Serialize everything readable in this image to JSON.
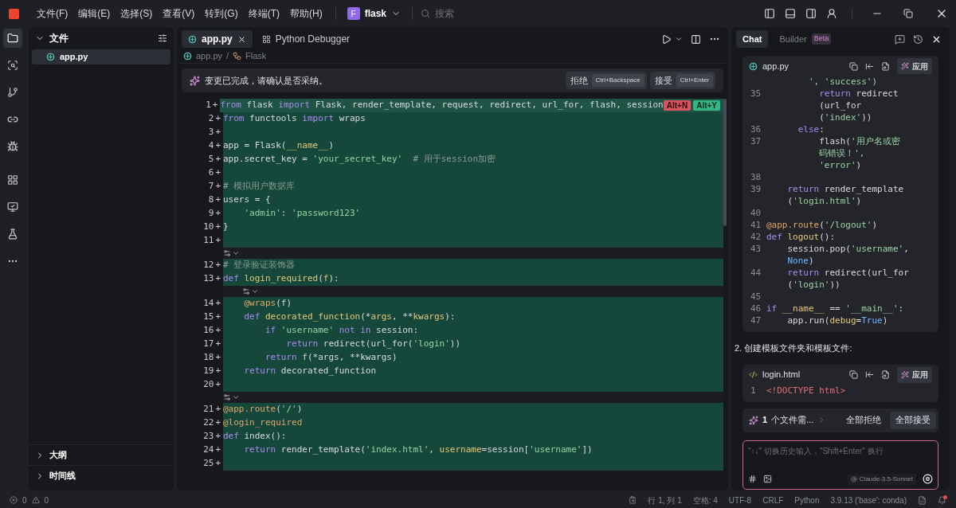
{
  "menu": [
    "文件(F)",
    "编辑(E)",
    "选择(S)",
    "查看(V)",
    "转到(G)",
    "终端(T)",
    "帮助(H)"
  ],
  "project": {
    "initial": "F",
    "name": "flask"
  },
  "search": {
    "placeholder": "搜索"
  },
  "activity_bar": [
    {
      "kind": "files",
      "selected": true
    },
    {
      "kind": "search",
      "selected": false
    },
    {
      "kind": "git",
      "selected": false
    },
    {
      "kind": "remote",
      "selected": false
    },
    {
      "kind": "debug",
      "selected": false
    },
    {
      "kind": "extensions",
      "selected": false
    },
    {
      "kind": "preview",
      "selected": false
    },
    {
      "kind": "testing",
      "selected": false
    },
    {
      "kind": "more",
      "selected": false
    }
  ],
  "sidebar": {
    "title": "文件",
    "files": [
      {
        "name": "app.py",
        "selected": true
      }
    ],
    "sections": [
      {
        "title": "大纲",
        "expanded": false
      },
      {
        "title": "时间线",
        "expanded": false
      }
    ]
  },
  "editor": {
    "tabs": [
      {
        "label": "app.py",
        "kind": "python",
        "selected": true
      },
      {
        "label": "Python Debugger",
        "kind": "extension",
        "selected": false
      }
    ],
    "breadcrumb": {
      "separator": "/",
      "items": [
        {
          "label": "app.py",
          "kind": "python"
        },
        {
          "label": "Flask",
          "kind": "symbol"
        }
      ]
    },
    "banner": {
      "message": "变更已完成，请确认是否采纳。",
      "actions": [
        {
          "label": "拒绝",
          "shortcut": "Ctrl+Backspace"
        },
        {
          "label": "接受",
          "shortcut": "Ctrl+Enter"
        }
      ]
    },
    "blocks": [
      {
        "kind": "lines",
        "lines": [
          {
            "num": "1",
            "mark": "+",
            "tokens": [
              {
                "kind": "keyword",
                "text": "from"
              },
              {
                "kind": "plain",
                "text": " flask "
              },
              {
                "kind": "keyword",
                "text": "import"
              },
              {
                "kind": "plain",
                "text": " Flask, render_template, request, redirect, url_for, flash, session"
              }
            ],
            "actions": [
              {
                "label": "Alt+N",
                "kind": "reject"
              },
              {
                "label": "Alt+Y",
                "kind": "accept"
              }
            ]
          },
          {
            "num": "2",
            "mark": "+",
            "tokens": [
              {
                "kind": "keyword",
                "text": "from"
              },
              {
                "kind": "plain",
                "text": " functools "
              },
              {
                "kind": "keyword",
                "text": "import"
              },
              {
                "kind": "plain",
                "text": " wraps"
              }
            ]
          },
          {
            "num": "3",
            "mark": "+"
          },
          {
            "num": "4",
            "mark": "+",
            "tokens": [
              {
                "kind": "plain",
                "text": "app = Flask("
              },
              {
                "kind": "function",
                "text": "__name__"
              },
              {
                "kind": "plain",
                "text": ")"
              }
            ]
          },
          {
            "num": "5",
            "mark": "+",
            "tokens": [
              {
                "kind": "plain",
                "text": "app.secret_key = "
              },
              {
                "kind": "string",
                "text": "'your_secret_key'"
              },
              {
                "kind": "comment",
                "text": "  # 用于session加密"
              }
            ]
          },
          {
            "num": "6",
            "mark": "+"
          },
          {
            "num": "7",
            "mark": "+",
            "tokens": [
              {
                "kind": "comment",
                "text": "# 模拟用户数据库"
              }
            ]
          },
          {
            "num": "8",
            "mark": "+",
            "tokens": [
              {
                "kind": "plain",
                "text": "users = {"
              }
            ]
          },
          {
            "num": "9",
            "mark": "+",
            "tokens": [
              {
                "kind": "string",
                "text": "    'admin'"
              },
              {
                "kind": "plain",
                "text": ": "
              },
              {
                "kind": "string",
                "text": "'password123'"
              }
            ]
          },
          {
            "num": "10",
            "mark": "+",
            "tokens": [
              {
                "kind": "plain",
                "text": "}"
              }
            ]
          },
          {
            "num": "11",
            "mark": "+"
          }
        ]
      },
      {
        "kind": "fold",
        "indented": false
      },
      {
        "kind": "lines",
        "lines": [
          {
            "num": "12",
            "mark": "+",
            "tokens": [
              {
                "kind": "comment",
                "text": "# 登录验证装饰器"
              }
            ]
          },
          {
            "num": "13",
            "mark": "+",
            "tokens": [
              {
                "kind": "keyword",
                "text": "def"
              },
              {
                "kind": "function",
                "text": " login_required"
              },
              {
                "kind": "plain",
                "text": "("
              },
              {
                "kind": "function",
                "text": "f"
              },
              {
                "kind": "plain",
                "text": "):"
              }
            ]
          }
        ]
      },
      {
        "kind": "fold",
        "indented": true
      },
      {
        "kind": "lines",
        "lines": [
          {
            "num": "14",
            "mark": "+",
            "tokens": [
              {
                "kind": "decorator",
                "text": "    @wraps"
              },
              {
                "kind": "plain",
                "text": "(f)"
              }
            ]
          },
          {
            "num": "15",
            "mark": "+",
            "tokens": [
              {
                "kind": "keyword",
                "text": "    def"
              },
              {
                "kind": "function",
                "text": " decorated_function"
              },
              {
                "kind": "plain",
                "text": "(*"
              },
              {
                "kind": "function",
                "text": "args"
              },
              {
                "kind": "plain",
                "text": ", **"
              },
              {
                "kind": "function",
                "text": "kwargs"
              },
              {
                "kind": "plain",
                "text": "):"
              }
            ]
          },
          {
            "num": "16",
            "mark": "+",
            "tokens": [
              {
                "kind": "keyword",
                "text": "        if"
              },
              {
                "kind": "string",
                "text": " 'username'"
              },
              {
                "kind": "keyword",
                "text": " not in"
              },
              {
                "kind": "plain",
                "text": " session:"
              }
            ]
          },
          {
            "num": "17",
            "mark": "+",
            "tokens": [
              {
                "kind": "keyword",
                "text": "            return"
              },
              {
                "kind": "plain",
                "text": " redirect(url_for("
              },
              {
                "kind": "string",
                "text": "'login'"
              },
              {
                "kind": "plain",
                "text": "))"
              }
            ]
          },
          {
            "num": "18",
            "mark": "+",
            "tokens": [
              {
                "kind": "keyword",
                "text": "        return"
              },
              {
                "kind": "plain",
                "text": " f(*args, **kwargs)"
              }
            ]
          },
          {
            "num": "19",
            "mark": "+",
            "tokens": [
              {
                "kind": "keyword",
                "text": "    return"
              },
              {
                "kind": "plain",
                "text": " decorated_function"
              }
            ]
          },
          {
            "num": "20",
            "mark": "+"
          }
        ]
      },
      {
        "kind": "fold",
        "indented": false
      },
      {
        "kind": "lines",
        "lines": [
          {
            "num": "21",
            "mark": "+",
            "tokens": [
              {
                "kind": "decorator",
                "text": "@app.route"
              },
              {
                "kind": "plain",
                "text": "("
              },
              {
                "kind": "string",
                "text": "'/'"
              },
              {
                "kind": "plain",
                "text": ")"
              }
            ]
          },
          {
            "num": "22",
            "mark": "+",
            "tokens": [
              {
                "kind": "decorator",
                "text": "@login_required"
              }
            ]
          },
          {
            "num": "23",
            "mark": "+",
            "tokens": [
              {
                "kind": "keyword",
                "text": "def"
              },
              {
                "kind": "plain",
                "text": " index():"
              }
            ]
          },
          {
            "num": "24",
            "mark": "+",
            "tokens": [
              {
                "kind": "keyword",
                "text": "    return"
              },
              {
                "kind": "plain",
                "text": " render_template("
              },
              {
                "kind": "string",
                "text": "'index.html'"
              },
              {
                "kind": "plain",
                "text": ", "
              },
              {
                "kind": "function",
                "text": "username"
              },
              {
                "kind": "plain",
                "text": "=session["
              },
              {
                "kind": "string",
                "text": "'username'"
              },
              {
                "kind": "plain",
                "text": "])"
              }
            ]
          },
          {
            "num": "25",
            "mark": "+"
          }
        ]
      }
    ]
  },
  "chat": {
    "tabs": [
      {
        "label": "Chat",
        "selected": true
      },
      {
        "label": "Builder",
        "badge": "Beta",
        "selected": false
      }
    ],
    "messages": [
      {
        "kind": "code",
        "file": {
          "name": "app.py",
          "kind": "python"
        },
        "apply": "应用",
        "rows": [
          {
            "tokens": [
              {
                "kind": "string",
                "text": "        ', 'success')"
              }
            ]
          },
          {
            "num": "35",
            "tokens": [
              {
                "kind": "keyword",
                "text": "          return"
              },
              {
                "kind": "plain",
                "text": " redirect"
              }
            ]
          },
          {
            "tokens": [
              {
                "kind": "plain",
                "text": "          (url_for"
              }
            ]
          },
          {
            "tokens": [
              {
                "kind": "plain",
                "text": "          ("
              },
              {
                "kind": "string",
                "text": "'index'"
              },
              {
                "kind": "plain",
                "text": "))"
              }
            ]
          },
          {
            "num": "36",
            "tokens": [
              {
                "kind": "keyword",
                "text": "      else"
              },
              {
                "kind": "plain",
                "text": ":"
              }
            ]
          },
          {
            "num": "37",
            "tokens": [
              {
                "kind": "plain",
                "text": "          flash("
              },
              {
                "kind": "string",
                "text": "'用户名或密"
              }
            ]
          },
          {
            "tokens": [
              {
                "kind": "string",
                "text": "          码错误！',"
              }
            ]
          },
          {
            "tokens": [
              {
                "kind": "string",
                "text": "          'error'"
              },
              {
                "kind": "plain",
                "text": ")"
              }
            ]
          },
          {
            "num": "38"
          },
          {
            "num": "39",
            "tokens": [
              {
                "kind": "keyword",
                "text": "    return"
              },
              {
                "kind": "plain",
                "text": " render_template"
              }
            ]
          },
          {
            "tokens": [
              {
                "kind": "plain",
                "text": "    ("
              },
              {
                "kind": "string",
                "text": "'login.html'"
              },
              {
                "kind": "plain",
                "text": ")"
              }
            ]
          },
          {
            "num": "40"
          },
          {
            "num": "41",
            "tokens": [
              {
                "kind": "decorator",
                "text": "@app.route"
              },
              {
                "kind": "plain",
                "text": "("
              },
              {
                "kind": "string",
                "text": "'/logout'"
              },
              {
                "kind": "plain",
                "text": ")"
              }
            ]
          },
          {
            "num": "42",
            "tokens": [
              {
                "kind": "keyword",
                "text": "def"
              },
              {
                "kind": "function",
                "text": " logout"
              },
              {
                "kind": "plain",
                "text": "():"
              }
            ]
          },
          {
            "num": "43",
            "tokens": [
              {
                "kind": "plain",
                "text": "    session.pop("
              },
              {
                "kind": "string",
                "text": "'username'"
              },
              {
                "kind": "plain",
                "text": ","
              }
            ]
          },
          {
            "tokens": [
              {
                "kind": "builtin",
                "text": "    None"
              },
              {
                "kind": "plain",
                "text": ")"
              }
            ]
          },
          {
            "num": "44",
            "tokens": [
              {
                "kind": "keyword",
                "text": "    return"
              },
              {
                "kind": "plain",
                "text": " redirect(url_for"
              }
            ]
          },
          {
            "tokens": [
              {
                "kind": "plain",
                "text": "    ("
              },
              {
                "kind": "string",
                "text": "'login'"
              },
              {
                "kind": "plain",
                "text": "))"
              }
            ]
          },
          {
            "num": "45"
          },
          {
            "num": "46",
            "tokens": [
              {
                "kind": "keyword",
                "text": "if"
              },
              {
                "kind": "function",
                "text": " __name__"
              },
              {
                "kind": "plain",
                "text": " == "
              },
              {
                "kind": "string",
                "text": "'__main__'"
              },
              {
                "kind": "plain",
                "text": ":"
              }
            ]
          },
          {
            "num": "47",
            "tokens": [
              {
                "kind": "plain",
                "text": "    app.run("
              },
              {
                "kind": "function",
                "text": "debug"
              },
              {
                "kind": "plain",
                "text": "="
              },
              {
                "kind": "builtin",
                "text": "True"
              },
              {
                "kind": "plain",
                "text": ")"
              }
            ]
          }
        ]
      },
      {
        "kind": "text",
        "text": "2. 创建模板文件夹和模板文件:"
      },
      {
        "kind": "code",
        "file": {
          "name": "login.html",
          "kind": "html"
        },
        "apply": "应用",
        "rows": [
          {
            "num": "1",
            "tokens": [
              {
                "kind": "tag",
                "text": "<!DOCTYPE html>"
              }
            ]
          }
        ]
      }
    ],
    "pending": {
      "count": "1",
      "label": "个文件需...",
      "reject_all": "全部拒绝",
      "accept_all": "全部接受"
    },
    "input": {
      "placeholder": "\"↑↓\" 切换历史输入，\"Shift+Enter\" 换行",
      "model": "Claude-3.5-Sonnet"
    }
  },
  "status_bar": {
    "errors": "0",
    "warnings": "0",
    "items": [
      "行 1, 列 1",
      "空格: 4",
      "UTF-8",
      "CRLF",
      "Python",
      "3.9.13 ('base': conda)"
    ],
    "unread_notifications": true
  }
}
